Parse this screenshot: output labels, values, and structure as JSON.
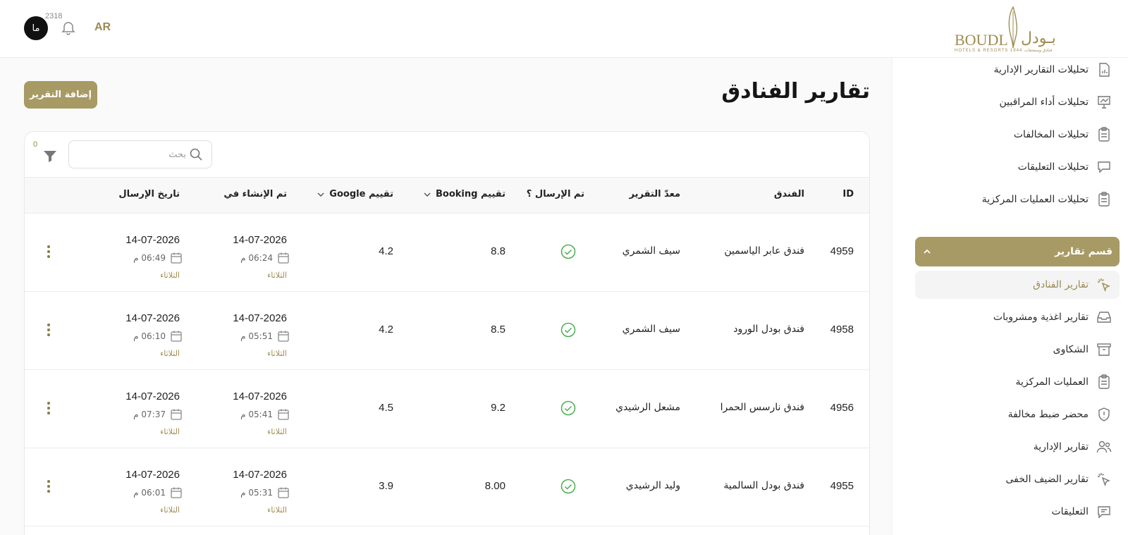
{
  "header": {
    "avatar_text": "ما",
    "notification_count": "2318",
    "language": "AR",
    "logo_latin": "BOUDL",
    "logo_arabic": "بـودل",
    "logo_subtitle": "HOTELS & RESORTS  1944  فنادق ومنتجعات"
  },
  "sidebar": {
    "items_top": [
      {
        "label": "تحليلات التقارير الإدارية",
        "icon": "report-chart-icon"
      },
      {
        "label": "تحليلات أداء المراقبين",
        "icon": "presentation-chart-icon"
      },
      {
        "label": "تحليلات المخالفات",
        "icon": "clipboard-icon"
      },
      {
        "label": "تحليلات التعليقات",
        "icon": "chat-bubbles-icon"
      },
      {
        "label": "تحليلات العمليات المركزية",
        "icon": "clipboard-icon"
      }
    ],
    "section_label": "قسم تقارير",
    "items_section": [
      {
        "label": "تقارير الفنادق",
        "icon": "cursor-click-icon"
      },
      {
        "label": "تقارير اغذية ومشروبات",
        "icon": "inbox-icon"
      },
      {
        "label": "الشكاوى",
        "icon": "archive-icon"
      },
      {
        "label": "العمليات المركزية",
        "icon": "clipboard-icon"
      },
      {
        "label": "محضر ضبط مخالفة",
        "icon": "shield-alert-icon"
      },
      {
        "label": "تقارير الإدارية",
        "icon": "users-icon"
      },
      {
        "label": "تقارير الضيف الخفى",
        "icon": "cursor-click-icon"
      },
      {
        "label": "التعليقات",
        "icon": "message-icon"
      }
    ]
  },
  "main": {
    "title": "تقارير الفنادق",
    "add_button": "إضافة التقرير",
    "search_placeholder": "بحث",
    "filter_count": "0"
  },
  "table": {
    "headers": {
      "id": "ID",
      "hotel": "الفندق",
      "author": "معدّ التقرير",
      "sent": "تم الإرسال ؟",
      "booking": "تقييم Booking",
      "google": "تقييم Google",
      "created": "تم الإنشاء في",
      "sent_date": "تاريخ الإرسال"
    },
    "rows": [
      {
        "id": "4959",
        "hotel": "فندق عابر الياسمين",
        "author": "سيف الشمري",
        "booking": "8.8",
        "google": "4.2",
        "created_date": "14-07-2026",
        "created_time": "06:24 م",
        "created_day": "الثلاثاء",
        "sent_date": "14-07-2026",
        "sent_time": "06:49 م",
        "sent_day": "الثلاثاء"
      },
      {
        "id": "4958",
        "hotel": "فندق بودل الورود",
        "author": "سيف الشمري",
        "booking": "8.5",
        "google": "4.2",
        "created_date": "14-07-2026",
        "created_time": "05:51 م",
        "created_day": "الثلاثاء",
        "sent_date": "14-07-2026",
        "sent_time": "06:10 م",
        "sent_day": "الثلاثاء"
      },
      {
        "id": "4956",
        "hotel": "فندق نارسس الحمرا",
        "author": "مشعل الرشيدي",
        "booking": "9.2",
        "google": "4.5",
        "created_date": "14-07-2026",
        "created_time": "05:41 م",
        "created_day": "الثلاثاء",
        "sent_date": "14-07-2026",
        "sent_time": "07:37 م",
        "sent_day": "الثلاثاء"
      },
      {
        "id": "4955",
        "hotel": "فندق بودل السالمية",
        "author": "وليد الرشيدي",
        "booking": "8.00",
        "google": "3.9",
        "created_date": "14-07-2026",
        "created_time": "05:31 م",
        "created_day": "الثلاثاء",
        "sent_date": "14-07-2026",
        "sent_time": "06:01 م",
        "sent_day": "الثلاثاء"
      }
    ]
  },
  "colors": {
    "brand": "#a89a64",
    "check": "#4caf50"
  }
}
